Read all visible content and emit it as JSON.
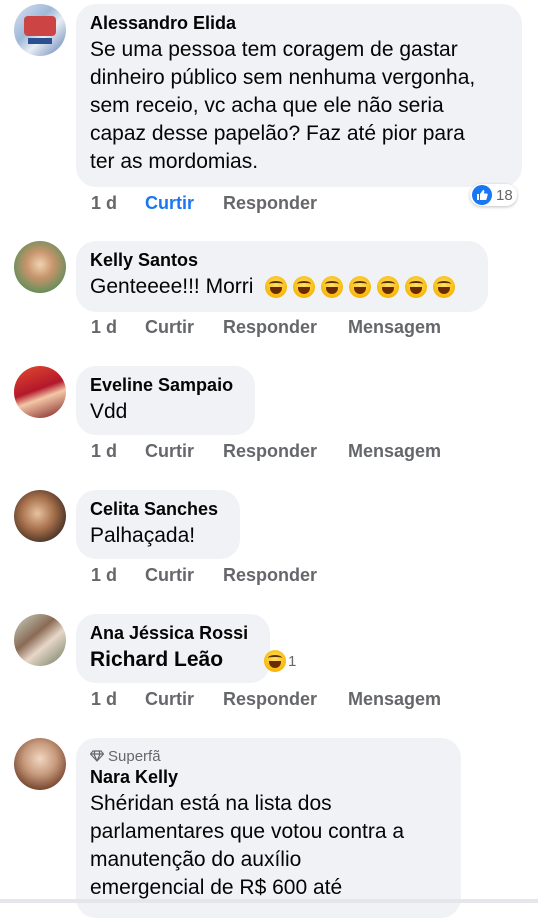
{
  "comments": [
    {
      "name": "Alessandro Elida",
      "lines": [
        "Se uma pessoa tem coragem de gastar",
        "dinheiro público sem nenhuma vergonha,",
        "sem receio, vc acha que ele não seria",
        "capaz desse papelão? Faz até pior para",
        "ter as mordomias."
      ],
      "time": "1 d",
      "like": "Curtir",
      "reply": "Responder",
      "reaction_count": "18"
    },
    {
      "name": "Kelly Santos",
      "text": "Genteeee!!! Morri",
      "time": "1 d",
      "like": "Curtir",
      "reply": "Responder",
      "message": "Mensagem"
    },
    {
      "name": "Eveline Sampaio",
      "text": "Vdd",
      "time": "1 d",
      "like": "Curtir",
      "reply": "Responder",
      "message": "Mensagem"
    },
    {
      "name": "Celita Sanches",
      "text": "Palhaçada!",
      "time": "1 d",
      "like": "Curtir",
      "reply": "Responder"
    },
    {
      "name": "Ana Jéssica Rossi",
      "text": "Richard Leão",
      "reaction_count": "1",
      "time": "1 d",
      "like": "Curtir",
      "reply": "Responder",
      "message": "Mensagem"
    },
    {
      "badge": "Superfã",
      "name": "Nara Kelly",
      "lines": [
        "Shéridan está na lista dos",
        "parlamentares que votou contra a",
        "manutenção do auxílio",
        "emergencial de R$ 600 até"
      ]
    }
  ],
  "colors": {
    "bubble": "#f0f2f5",
    "action": "#65676b",
    "liked": "#1877f2"
  },
  "icons": [
    "laughing-emoji-icon",
    "like-reaction-icon",
    "superfan-diamond-icon"
  ]
}
